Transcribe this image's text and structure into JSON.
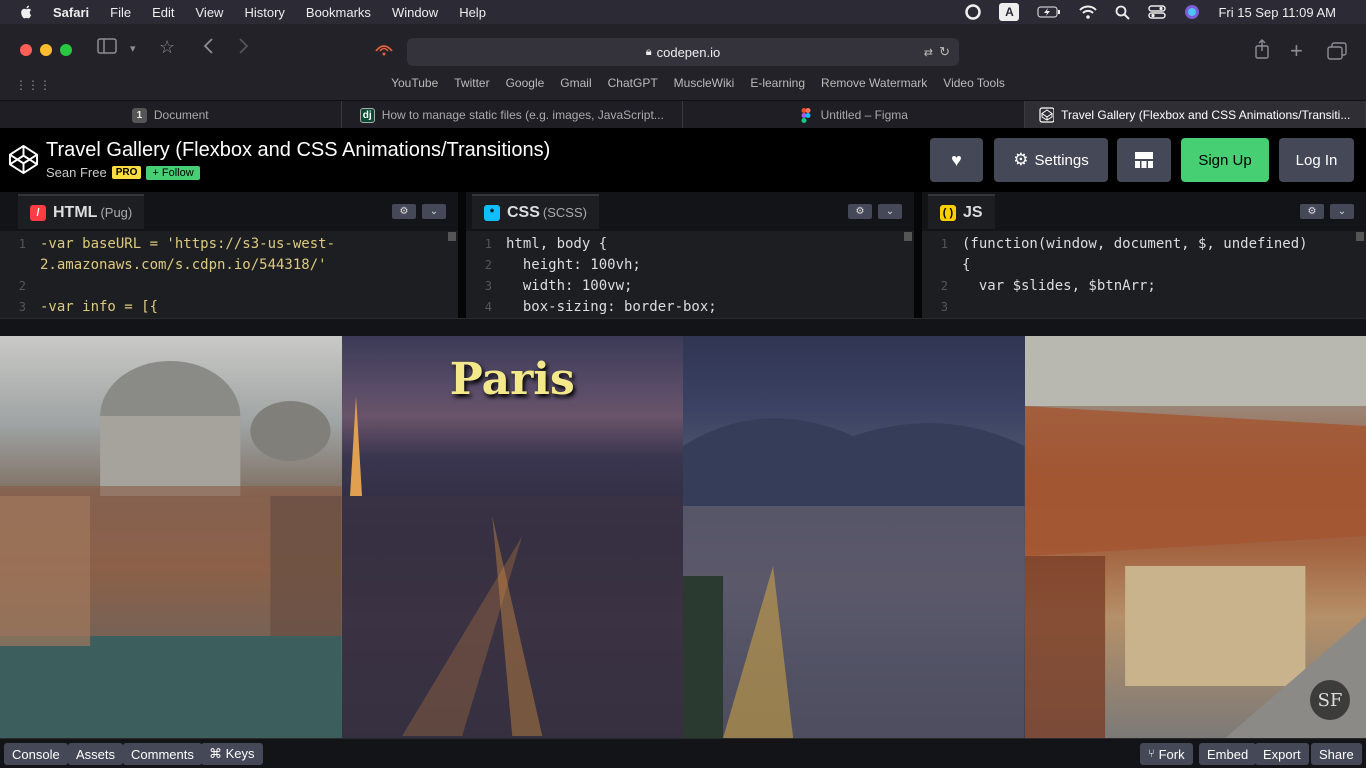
{
  "menubar": {
    "app": "Safari",
    "items": [
      "File",
      "Edit",
      "View",
      "History",
      "Bookmarks",
      "Window",
      "Help"
    ],
    "clock": "Fri 15 Sep  11:09 AM",
    "input_badge": "A"
  },
  "browser": {
    "url": "codepen.io",
    "favorites": [
      "YouTube",
      "Twitter",
      "Google",
      "Gmail",
      "ChatGPT",
      "MuscleWiki",
      "E-learning",
      "Remove Watermark",
      "Video Tools"
    ],
    "tabs": [
      {
        "label": "Document",
        "badge": "1"
      },
      {
        "label": "How to manage static files (e.g. images, JavaScript...",
        "badge": "dj"
      },
      {
        "label": "Untitled – Figma",
        "badge": ""
      },
      {
        "label": "Travel Gallery (Flexbox and CSS Animations/Transiti...",
        "badge": ""
      }
    ]
  },
  "pen": {
    "title": "Travel Gallery (Flexbox and CSS Animations/Transitions)",
    "author": "Sean Free",
    "pro": "PRO",
    "follow": "+ Follow",
    "buttons": {
      "settings": "Settings",
      "signup": "Sign Up",
      "login": "Log In"
    }
  },
  "editors": {
    "html": {
      "name": "HTML",
      "sub": "(Pug)",
      "lines": [
        {
          "n": "1",
          "t": "-var baseURL = 'https://s3-us-west-"
        },
        {
          "n": "",
          "t": "2.amazonaws.com/s.cdpn.io/544318/'"
        },
        {
          "n": "2",
          "t": ""
        },
        {
          "n": "3",
          "t": "-var info = [{"
        }
      ]
    },
    "css": {
      "name": "CSS",
      "sub": "(SCSS)",
      "lines": [
        {
          "n": "1",
          "t": "html, body {"
        },
        {
          "n": "2",
          "t": "  height: 100vh;"
        },
        {
          "n": "3",
          "t": "  width: 100vw;"
        },
        {
          "n": "4",
          "t": "  box-sizing: border-box;"
        }
      ]
    },
    "js": {
      "name": "JS",
      "sub": "",
      "lines": [
        {
          "n": "1",
          "t": "(function(window, document, $, undefined)"
        },
        {
          "n": "",
          "t": "{"
        },
        {
          "n": "2",
          "t": "  var $slides, $btnArr;"
        },
        {
          "n": "3",
          "t": ""
        }
      ]
    }
  },
  "gallery": {
    "featured_title": "Paris",
    "badge": "SF"
  },
  "footer": {
    "left": [
      "Console",
      "Assets",
      "Comments",
      "⌘ Keys"
    ],
    "right": [
      "Fork",
      "Embed",
      "Export",
      "Share"
    ]
  },
  "colors": {
    "signup": "#47cf73",
    "pro": "#ffdd40",
    "title": "#f3e98a"
  }
}
